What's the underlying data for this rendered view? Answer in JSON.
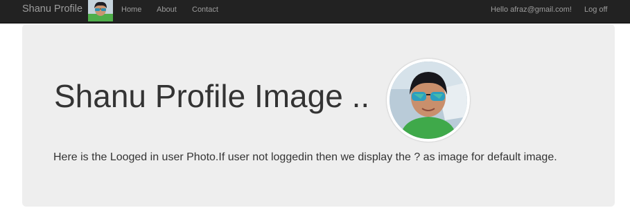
{
  "navbar": {
    "brand": "Shanu Profile",
    "links": [
      "Home",
      "About",
      "Contact"
    ],
    "greeting": "Hello afraz@gmail.com!",
    "logoff": "Log off",
    "background": "#222222",
    "link_color": "#9d9d9d"
  },
  "jumbotron": {
    "title": "Shanu Profile Image ..",
    "description": "Here is the Looged in user Photo.If user not loggedin then we display the ? as image for default image.",
    "background": "#eeeeee"
  },
  "icons": {
    "nav_avatar": "user-avatar-photo",
    "profile_photo": "user-profile-photo"
  }
}
